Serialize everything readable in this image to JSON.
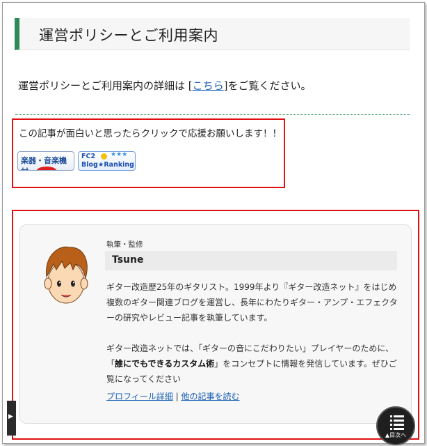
{
  "heading": {
    "title": "運営ポリシーとご利用案内"
  },
  "policy": {
    "prefix": "運営ポリシーとご利用案内の詳細は [",
    "link": "こちら",
    "suffix": "]をご覧ください。"
  },
  "ranking": {
    "message": "この記事が面白いと思ったらクリックで応援お願いします！！",
    "badge1": "楽器・音楽機材",
    "badge2_top": "FC2",
    "badge2_stars": "★★★",
    "badge2_bottom": "Blog★Ranking"
  },
  "author": {
    "role": "執筆・監修",
    "name": "Tsune",
    "bio1": "ギター改造歴25年のギタリスト。1999年より『ギター改造ネット』をはじめ複数のギター関連ブログを運営し、長年にわたりギター・アンプ・エフェクターの研究やレビュー記事を執筆しています。",
    "bio2_a": "ギター改造ネットでは、「ギターの音にこだわりたい」プレイヤーのために、「",
    "bio2_bold": "誰にでもできるカスタム術",
    "bio2_b": "」をコンセプトに情報を発信しています。ぜひご覧になってください",
    "link_profile": "プロフィール詳細",
    "link_separator": " | ",
    "link_articles": "他の記事を読む"
  },
  "toc": {
    "label": "▲目次へ",
    "icon": "list-icon"
  },
  "side_tab": {
    "icon": "caret-right-icon",
    "glyph": "▶"
  },
  "colors": {
    "accent": "#2e8b57",
    "highlight_border": "#e01010",
    "link": "#1a5fb4"
  }
}
